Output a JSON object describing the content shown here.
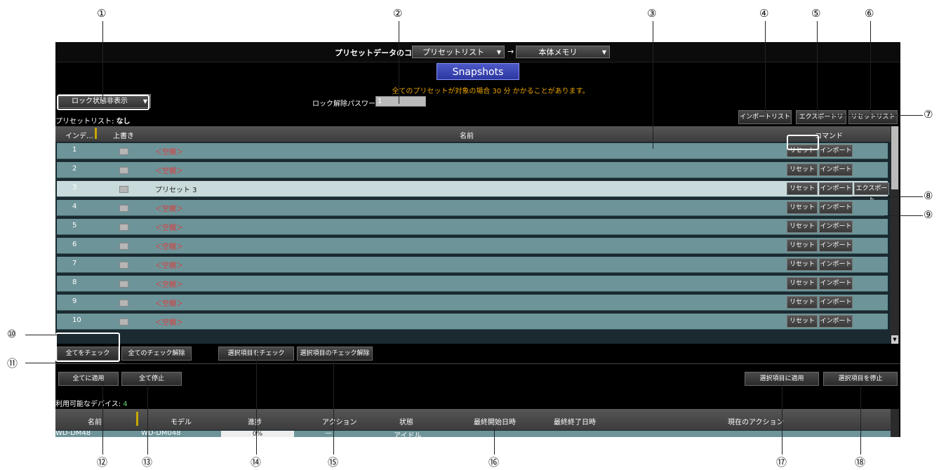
{
  "header": {
    "copy_label": "プリセットデータのコピー",
    "source_dropdown": "プリセットリスト",
    "arrow": "→",
    "dest_dropdown": "本体メモリ",
    "snapshots_button": "Snapshots",
    "warning_text": "全てのプリセットが対象の場合 30 分 かかることがあります。"
  },
  "toolbar": {
    "lock_display_dropdown": "ロック状態非表示",
    "password_label": "ロック解除パスワード:",
    "password_value": "1",
    "import_list": "インポートリスト",
    "export_list": "エクスポートリスト",
    "reset_list": "リセットリスト"
  },
  "preset_list_label": "プリセットリスト:",
  "preset_list_value": "なし",
  "grid": {
    "columns": [
      "インデ…",
      "上書き",
      "名前",
      "コマンド"
    ],
    "rows": [
      {
        "index": "1",
        "name": "＜空欄＞",
        "commands": [
          "リセット",
          "インポート"
        ]
      },
      {
        "index": "2",
        "name": "＜空欄＞",
        "commands": [
          "リセット",
          "インポート"
        ]
      },
      {
        "index": "3",
        "name": "プリセット 3",
        "commands": [
          "リセット",
          "インポート",
          "エクスポート"
        ]
      },
      {
        "index": "4",
        "name": "＜空欄＞",
        "commands": [
          "リセット",
          "インポート"
        ]
      },
      {
        "index": "5",
        "name": "＜空欄＞",
        "commands": [
          "リセット",
          "インポート"
        ]
      },
      {
        "index": "6",
        "name": "＜空欄＞",
        "commands": [
          "リセット",
          "インポート"
        ]
      },
      {
        "index": "7",
        "name": "＜空欄＞",
        "commands": [
          "リセット",
          "インポート"
        ]
      },
      {
        "index": "8",
        "name": "＜空欄＞",
        "commands": [
          "リセット",
          "インポート"
        ]
      },
      {
        "index": "9",
        "name": "＜空欄＞",
        "commands": [
          "リセット",
          "インポート"
        ]
      },
      {
        "index": "10",
        "name": "＜空欄＞",
        "commands": [
          "リセット",
          "インポート"
        ]
      }
    ]
  },
  "check_buttons": {
    "check_all": "全てをチェック",
    "uncheck_all": "全てのチェック解除",
    "check_selected": "選択項目をチェック",
    "uncheck_selected": "選択項目のチェック解除"
  },
  "apply_buttons": {
    "apply_all": "全てに適用",
    "stop_all": "全て停止",
    "apply_selected": "選択項目に適用",
    "stop_selected": "選択項目を停止"
  },
  "devices": {
    "label": "利用可能なデバイス:",
    "count": "4",
    "columns": [
      "名前",
      "モデル",
      "進捗",
      "アクション",
      "状態",
      "最終開始日時",
      "最終終了日時",
      "現在のアクション"
    ],
    "row": {
      "name": "WD-DM48",
      "model": "WD-DM048",
      "progress": "0%",
      "action": "—",
      "status": "アイドル"
    }
  },
  "callouts": [
    "①",
    "②",
    "③",
    "④",
    "⑤",
    "⑥",
    "⑦",
    "⑧",
    "⑨",
    "⑩",
    "⑪",
    "⑫",
    "⑬",
    "⑭",
    "⑮",
    "⑯",
    "⑰",
    "⑱"
  ]
}
